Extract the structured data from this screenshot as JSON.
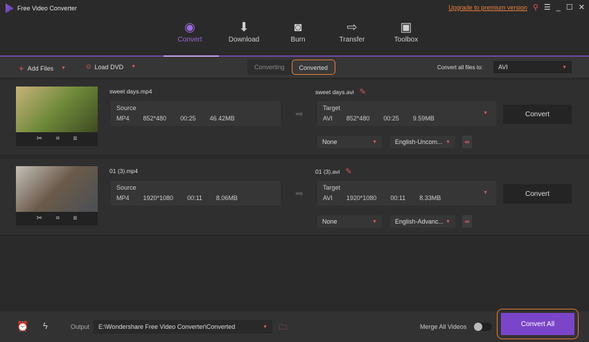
{
  "app": {
    "title": "Free Video Converter",
    "upgrade": "Upgrade to premium version"
  },
  "nav": [
    {
      "label": "Convert",
      "icon": "convert-icon"
    },
    {
      "label": "Download",
      "icon": "download-icon"
    },
    {
      "label": "Burn",
      "icon": "burn-icon"
    },
    {
      "label": "Transfer",
      "icon": "transfer-icon"
    },
    {
      "label": "Toolbox",
      "icon": "toolbox-icon"
    }
  ],
  "toolbar": {
    "add_files": "Add Files",
    "load_dvd": "Load DVD",
    "tabs": [
      "Converting",
      "Converted"
    ],
    "convert_all_label": "Convert all files to:",
    "format": "AVI"
  },
  "files": [
    {
      "name": "sweet days.mp4",
      "source_label": "Source",
      "src": {
        "format": "MP4",
        "res": "852*480",
        "dur": "00:25",
        "size": "46.42MB"
      },
      "target_name": "sweet days.avi",
      "target_label": "Target",
      "tgt": {
        "format": "AVI",
        "res": "852*480",
        "dur": "00:25",
        "size": "9.59MB"
      },
      "subtitle": "None",
      "audio": "English-Uncom...",
      "convert": "Convert"
    },
    {
      "name": "01 (3).mp4",
      "source_label": "Source",
      "src": {
        "format": "MP4",
        "res": "1920*1080",
        "dur": "00:11",
        "size": "8.06MB"
      },
      "target_name": "01 (3).avi",
      "target_label": "Target",
      "tgt": {
        "format": "AVI",
        "res": "1920*1080",
        "dur": "00:11",
        "size": "8.33MB"
      },
      "subtitle": "None",
      "audio": "English-Advanc...",
      "convert": "Convert"
    }
  ],
  "bottom": {
    "output_label": "Output",
    "output_path": "E:\\Wondershare Free Video Converter\\Converted",
    "merge": "Merge All Videos",
    "merge_on": false,
    "convert_all": "Convert All"
  },
  "colors": {
    "accent": "#7a45c8",
    "highlight": "#e8803a"
  }
}
